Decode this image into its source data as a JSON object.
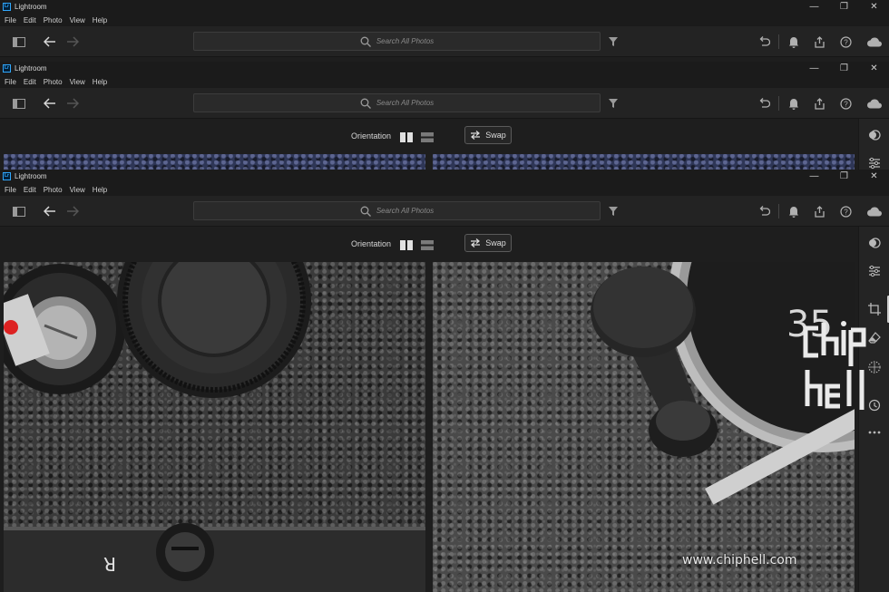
{
  "app": {
    "title": "Lightroom",
    "logo": "Lr"
  },
  "window_controls": {
    "minimize": "—",
    "restore": "❐",
    "close": "✕"
  },
  "menu": [
    "File",
    "Edit",
    "Photo",
    "View",
    "Help"
  ],
  "search": {
    "placeholder": "Search All Photos"
  },
  "compare": {
    "orientation_label": "Orientation",
    "swap_label": "Swap"
  },
  "icons": {
    "toolbar": [
      "panel-toggle-icon",
      "back-arrow-icon",
      "forward-arrow-icon",
      "search-icon",
      "filter-icon",
      "undo-icon",
      "bell-icon",
      "share-icon",
      "help-icon",
      "cloud-icon"
    ],
    "right_panel": [
      "presets-icon",
      "edit-sliders-icon",
      "crop-icon",
      "healing-eraser-icon",
      "masking-icon",
      "versions-history-icon",
      "more-icon"
    ]
  },
  "photo_overlay": {
    "dial_number": "35",
    "letter": "R"
  },
  "watermark": {
    "site": "www.chiphell.com",
    "logo_text": "chip hell"
  },
  "colors": {
    "accent": "#31a8ff",
    "background": "#1e1e1e",
    "toolbar": "#232323"
  }
}
